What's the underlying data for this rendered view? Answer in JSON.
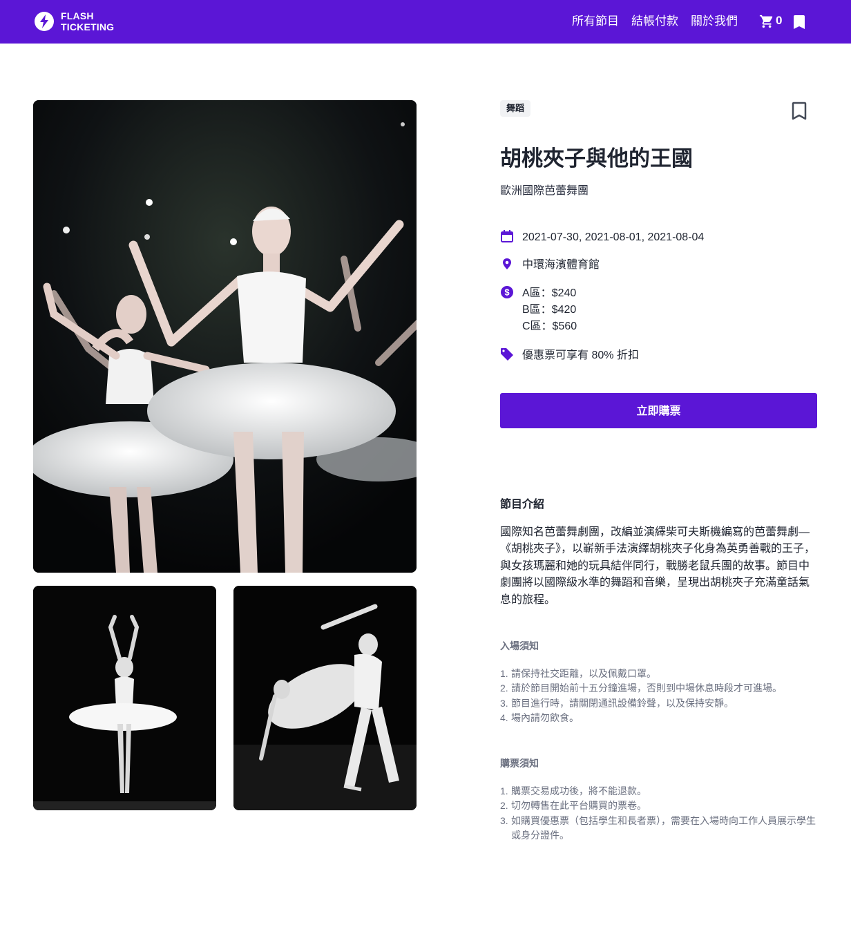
{
  "brand": {
    "line1": "FLASH",
    "line2": "TICKETING",
    "icon": "lightning-bolt-icon"
  },
  "nav": {
    "links": [
      "所有節目",
      "結帳付款",
      "關於我們"
    ],
    "cart_count": "0",
    "cart_icon": "cart-icon",
    "bookmark_icon": "bookmark-icon"
  },
  "event": {
    "category": "舞蹈",
    "title": "胡桃夾子與他的王國",
    "performer": "歐洲國際芭蕾舞團",
    "dates": "2021-07-30, 2021-08-01, 2021-08-04",
    "venue": "中環海濱體育館",
    "prices": [
      "A區：$240",
      "B區：$420",
      "C區：$560"
    ],
    "discount": "優惠票可享有 80% 折扣",
    "buy_label": "立即購票"
  },
  "intro": {
    "heading": "節目介紹",
    "body": "國際知名芭蕾舞劇團，改編並演繹柴可夫斯機編寫的芭蕾舞劇—《胡桃夾子》，以嶄新手法演繹胡桃夾子化身為英勇善戰的王子，與女孩瑪麗和她的玩具結伴同行，戰勝老鼠兵團的故事。節目中劇團將以國際級水準的舞蹈和音樂，呈現出胡桃夾子充滿童話氣息的旅程。"
  },
  "entry_rules": {
    "heading": "入場須知",
    "items": [
      "請保持社交距離，以及佩戴口罩。",
      "請於節目開始前十五分鐘進場，否則到中場休息時段才可進場。",
      "節目進行時，請關閉通訊設備鈴聲，以及保持安靜。",
      "場內請勿飲食。"
    ]
  },
  "purchase_rules": {
    "heading": "購票須知",
    "items": [
      "購票交易成功後，將不能退款。",
      "切勿轉售在此平台購買的票卷。",
      "如購買優惠票（包括學生和長者票），需要在入場時向工作人員展示學生或身分證件。"
    ]
  },
  "colors": {
    "brand": "#5b16d6",
    "text": "#1f2430",
    "muted": "#6b7080"
  }
}
